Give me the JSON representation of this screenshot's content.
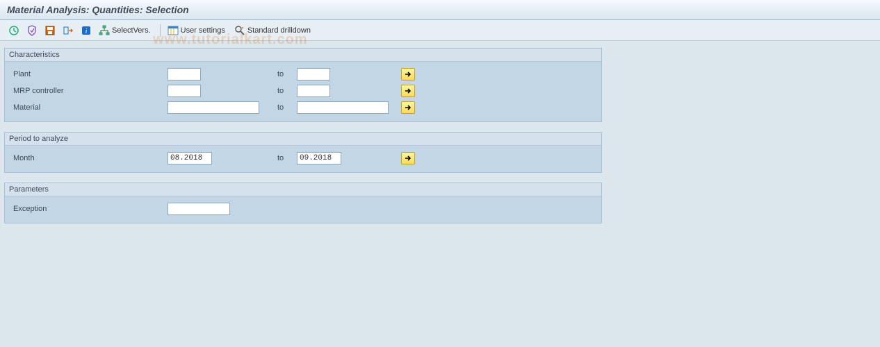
{
  "header": {
    "title": "Material Analysis: Quantities: Selection"
  },
  "toolbar": {
    "select_vers_label": "SelectVers.",
    "user_settings_label": "User settings",
    "standard_drilldown_label": "Standard drilldown"
  },
  "groups": {
    "characteristics": {
      "title": "Characteristics",
      "plant_label": "Plant",
      "plant_from": "",
      "plant_to": "",
      "mrp_label": "MRP controller",
      "mrp_from": "",
      "mrp_to": "",
      "material_label": "Material",
      "material_from": "",
      "material_to": "",
      "to_label": "to"
    },
    "period": {
      "title": "Period to analyze",
      "month_label": "Month",
      "month_from": "08.2018",
      "month_to": "09.2018",
      "to_label": "to"
    },
    "parameters": {
      "title": "Parameters",
      "exception_label": "Exception",
      "exception_value": ""
    }
  },
  "watermark": "www.tutorialkart.com"
}
